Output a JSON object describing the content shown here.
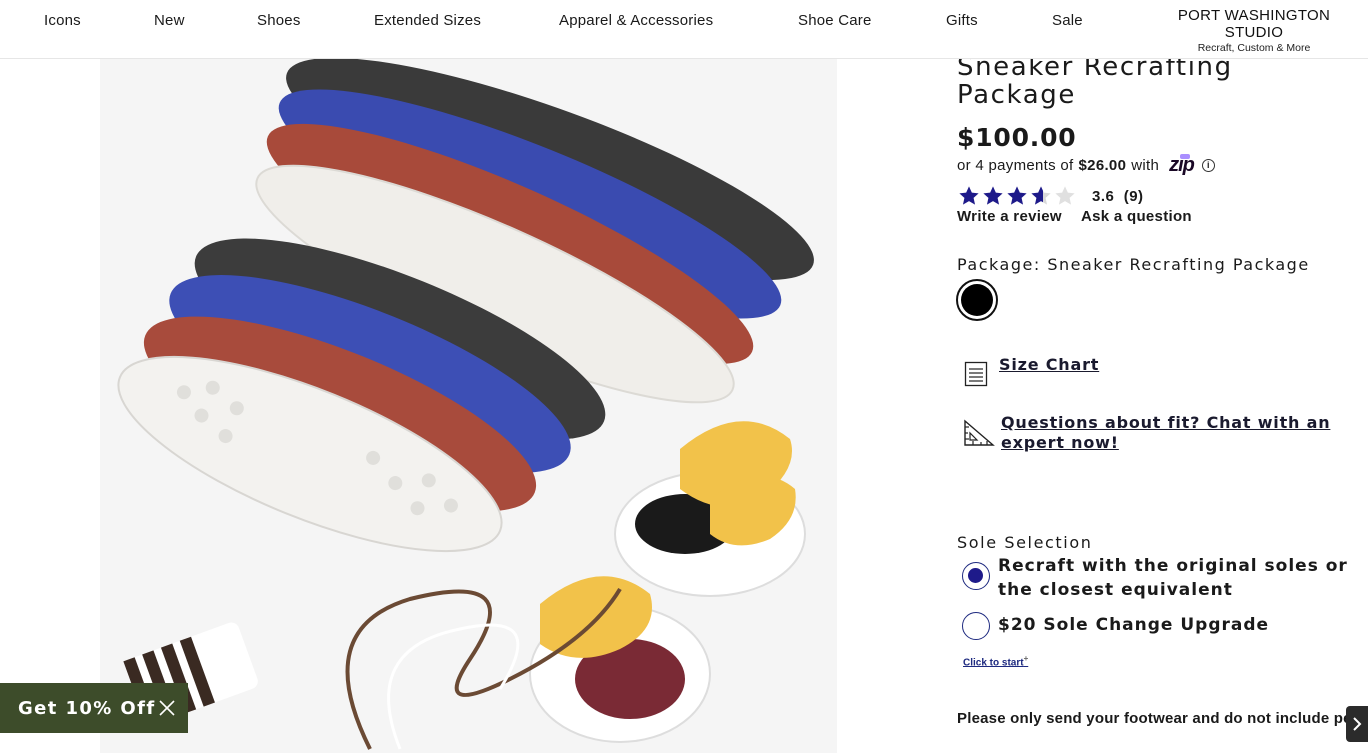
{
  "nav": {
    "items": [
      "Icons",
      "New",
      "Shoes",
      "Extended Sizes",
      "Apparel & Accessories",
      "Shoe Care",
      "Gifts",
      "Sale"
    ],
    "brand": {
      "name": "PORT WASHINGTON STUDIO",
      "subtitle": "Recraft, Custom & More"
    }
  },
  "product": {
    "title": "Sneaker Recrafting Package",
    "price": "$100.00",
    "payments": {
      "prefix": "or 4 payments of",
      "amount": "$26.00",
      "suffix": "with",
      "provider": "zip"
    },
    "rating": {
      "value": 3.6,
      "display": "3.6",
      "count": "(9)",
      "max_stars": 5
    },
    "links": {
      "write_review": "Write a review",
      "ask_question": "Ask a question"
    },
    "package_label": "Package:",
    "package_value": "Sneaker Recrafting Package",
    "size_chart": "Size Chart",
    "fit_chat": "Questions about fit? Chat with an expert now!",
    "sole_selection": {
      "title": "Sole Selection",
      "options": [
        {
          "label": "Recraft with the original soles or the closest equivalent",
          "selected": true
        },
        {
          "label": "$20 Sole Change Upgrade",
          "selected": false
        }
      ],
      "click_to_start": "Click to start",
      "click_sup": "+"
    },
    "notice": "Please only send your footwear and do not include personal items."
  },
  "promo": {
    "label": "Get 10% Off"
  },
  "colors": {
    "accent_navy": "#1e1a8a",
    "promo_bg": "#3d4c2a",
    "star": "#1e1a8a",
    "zip_purple": "#aa8fff"
  },
  "icons": [
    "close-icon",
    "chevron-right-icon",
    "document-icon",
    "ruler-triangle-icon",
    "info-icon",
    "star-icon"
  ]
}
